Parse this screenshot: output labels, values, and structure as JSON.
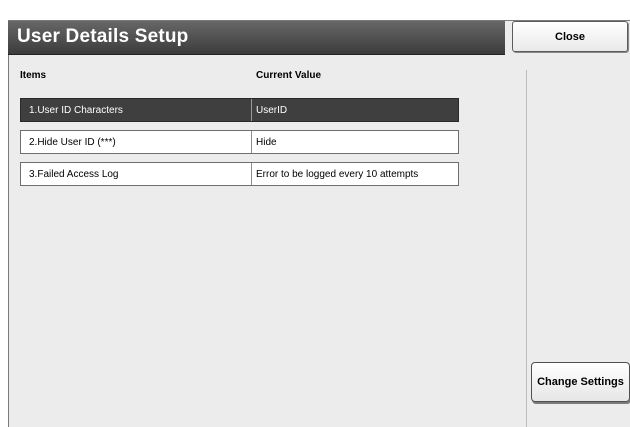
{
  "window": {
    "title": "User Details Setup",
    "close_label": "Close"
  },
  "table": {
    "headers": {
      "items": "Items",
      "current_value": "Current Value"
    },
    "rows": [
      {
        "item": "1.User ID Characters",
        "value": "UserID",
        "selected": true
      },
      {
        "item": "2.Hide User ID (***)",
        "value": "Hide",
        "selected": false
      },
      {
        "item": "3.Failed Access Log",
        "value": "Error to be logged every 10 attempts",
        "selected": false
      }
    ]
  },
  "actions": {
    "change_settings_label": "Change Settings"
  }
}
